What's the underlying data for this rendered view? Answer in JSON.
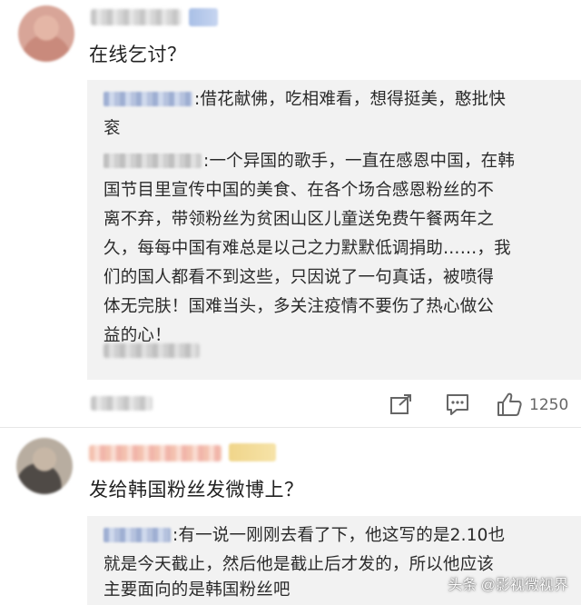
{
  "comments": [
    {
      "text": "在线乞讨？",
      "replies": [
        {
          "name_suffix": ":",
          "lines": [
            "借花献佛，吃相难看，想得挺美，憨批快",
            "衮"
          ]
        },
        {
          "name_suffix": ":",
          "lines": [
            "一个异国的歌手，一直在感恩中国，在韩",
            "国节目里宣传中国的美食、在各个场合感恩粉丝的不",
            "离不弃，带领粉丝为贫困山区儿童送免费午餐两年之",
            "久，每每中国有难总是以己之力默默低调捐助……，我",
            "们的国人都看不到这些，只因说了一句真话，被喷得",
            "体无完肤！国难当头，多关注疫情不要伤了热心做公",
            "益的心！"
          ]
        }
      ],
      "like_count": "1250"
    },
    {
      "text": "发给韩国粉丝发微博上？",
      "replies": [
        {
          "name_suffix": ":",
          "lines": [
            "有一说一刚刚去看了下，他这写的是2.10也",
            "就是今天截止，然后他是截止后才发的，所以他应该",
            "主要面向的是韩国粉丝吧"
          ]
        }
      ]
    }
  ],
  "icons": {
    "share": "share-icon",
    "comment": "comment-icon",
    "like": "thumbs-up-icon"
  },
  "watermark": "头条 @影视微视界",
  "colors": {
    "reply_bg": "#f2f2f2",
    "text": "#222222",
    "muted": "#666666"
  }
}
